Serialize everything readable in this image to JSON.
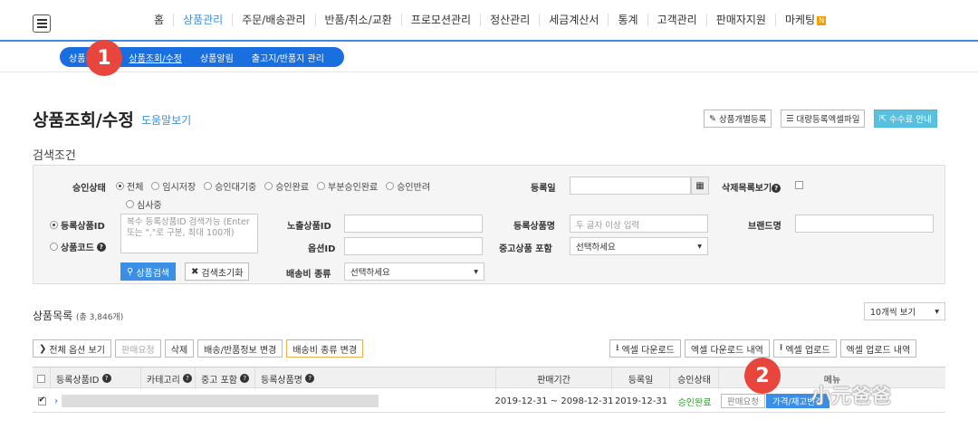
{
  "nav": {
    "items": [
      {
        "label": "홈",
        "active": false
      },
      {
        "label": "상품관리",
        "active": true
      },
      {
        "label": "주문/배송관리",
        "active": false
      },
      {
        "label": "반품/취소/교환",
        "active": false
      },
      {
        "label": "프로모션관리",
        "active": false
      },
      {
        "label": "정산관리",
        "active": false
      },
      {
        "label": "세금계산서",
        "active": false
      },
      {
        "label": "통계",
        "active": false
      },
      {
        "label": "고객관리",
        "active": false
      },
      {
        "label": "판매자지원",
        "active": false
      },
      {
        "label": "마케팅",
        "active": false
      }
    ],
    "new_badge": "N"
  },
  "subnav": {
    "items": [
      "상품",
      "상품조회/수정",
      "상품알림",
      "출고지/반품지 관리"
    ],
    "active": "상품조회/수정"
  },
  "annotations": {
    "circle1": "1",
    "circle2": "2"
  },
  "page": {
    "title": "상품조회/수정",
    "help_link": "도움말보기",
    "buttons": {
      "register": "상품개별등록",
      "bulk": "대량등록엑셀파일",
      "fee": "수수료 안내"
    }
  },
  "search": {
    "section_label": "검색조건",
    "approval": {
      "label": "승인상태",
      "options": [
        "전체",
        "임시저장",
        "승인대기중",
        "승인완료",
        "부분승인완료",
        "승인반려",
        "심사중"
      ],
      "selected": "전체"
    },
    "regdate_label": "등록일",
    "deleted_label": "삭제목록보기",
    "product_id_label": "등록상품ID",
    "product_code_label": "상품코드",
    "product_id_placeholder": "복수 등록상품ID 검색가능 (Enter 또는 \",\"로 구분, 최대 100개)",
    "exposure_label": "노출상품ID",
    "option_label": "옵션ID",
    "product_name_label": "등록상품명",
    "product_name_placeholder": "두 글자 이상 입력",
    "brand_label": "브랜드명",
    "used_label": "중고상품 포함",
    "used_value": "선택하세요",
    "shipping_label": "배송비 종류",
    "shipping_value": "선택하세요",
    "search_button": "상품검색",
    "reset_button": "검색초기화"
  },
  "list": {
    "title": "상품목록",
    "count": "(총 3,846개)",
    "per_page": "10개씩 보기",
    "actions": {
      "all_options": "전체 옵션 보기",
      "sale_request": "판매요청",
      "delete": "삭제",
      "shipping_change": "배송/반품정보 변경",
      "shipping_fee_change": "배송비 종류 변경",
      "excel_download": "엑셀 다운로드",
      "excel_download_history": "엑셀 다운로드 내역",
      "excel_upload": "엑셀 업로드",
      "excel_upload_history": "엑셀 업로드 내역"
    },
    "columns": [
      "등록상품ID",
      "카테고리",
      "중고 포함",
      "등록상품명",
      "판매기간",
      "등록일",
      "승인상태",
      "메뉴"
    ],
    "row": {
      "period": "2019-12-31 ~ 2098-12-31",
      "regdate": "2019-12-31",
      "status": "승인완료",
      "sale_request": "판매요청",
      "price_stock": "가격/재고변경"
    }
  },
  "watermark": "小元爸爸"
}
